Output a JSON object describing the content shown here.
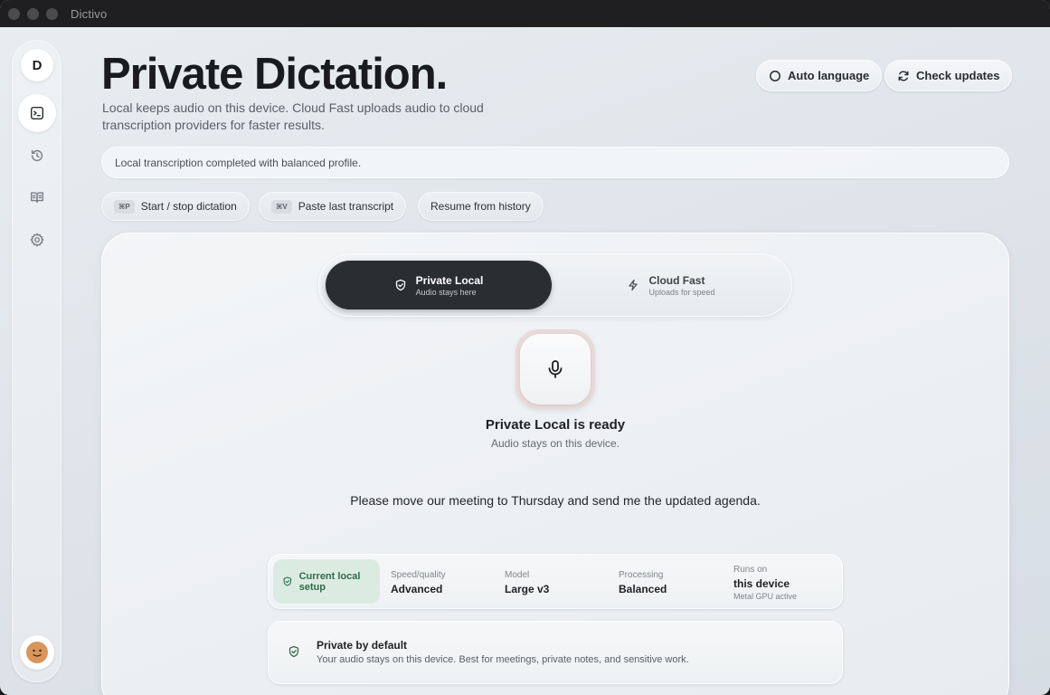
{
  "window": {
    "title": "Dictivo"
  },
  "sidebar": {
    "logo": "D",
    "items": [
      {
        "name": "dictation",
        "icon": "terminal-icon",
        "active": true
      },
      {
        "name": "history",
        "icon": "history-icon",
        "active": false
      },
      {
        "name": "dictionary",
        "icon": "book-icon",
        "active": false
      },
      {
        "name": "settings",
        "icon": "gear-icon",
        "active": false
      }
    ],
    "avatar": "avatar-face-icon"
  },
  "header": {
    "title": "Private Dictation.",
    "description": "Local keeps audio on this device. Cloud Fast uploads audio to cloud transcription providers for faster results.",
    "auto_language_label": "Auto language",
    "check_updates_label": "Check updates"
  },
  "status": {
    "message": "Local transcription completed with balanced profile."
  },
  "shortcuts": [
    {
      "kbd": "⌘P",
      "label": "Start / stop dictation"
    },
    {
      "kbd": "⌘V",
      "label": "Paste last transcript"
    },
    {
      "kbd": "",
      "label": "Resume from history"
    }
  ],
  "mode_toggle": {
    "local": {
      "title": "Private Local",
      "subtitle": "Audio stays here"
    },
    "cloud": {
      "title": "Cloud Fast",
      "subtitle": "Uploads for speed"
    }
  },
  "ready": {
    "title": "Private Local is ready",
    "subtitle": "Audio stays on this device."
  },
  "transcript": "Please move our meeting to Thursday and send me the updated agenda.",
  "setup": {
    "chip_label": "Current local setup",
    "speed_quality": {
      "label": "Speed/quality",
      "value": "Advanced"
    },
    "model": {
      "label": "Model",
      "value": "Large v3"
    },
    "processing": {
      "label": "Processing",
      "value": "Balanced"
    },
    "runs_on": {
      "label": "Runs on",
      "value": "this device",
      "note": "Metal GPU active"
    }
  },
  "privacy": {
    "title": "Private by default",
    "description": "Your audio stays on this device. Best for meetings, private notes, and sensitive work."
  },
  "colors": {
    "accent_dark": "#2b2e31",
    "setup_green": "#2f6b4a",
    "setup_green_bg": "#dcebe2",
    "mic_ring": "#e9d9d9"
  }
}
